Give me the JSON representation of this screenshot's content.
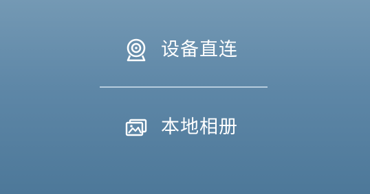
{
  "menu": {
    "items": [
      {
        "label": "设备直连",
        "icon": "webcam-icon"
      },
      {
        "label": "本地相册",
        "icon": "photo-album-icon"
      }
    ]
  },
  "colors": {
    "background_top": "#7499b4",
    "background_bottom": "#4d7899",
    "text": "#ffffff",
    "divider": "#d6e4f0"
  }
}
